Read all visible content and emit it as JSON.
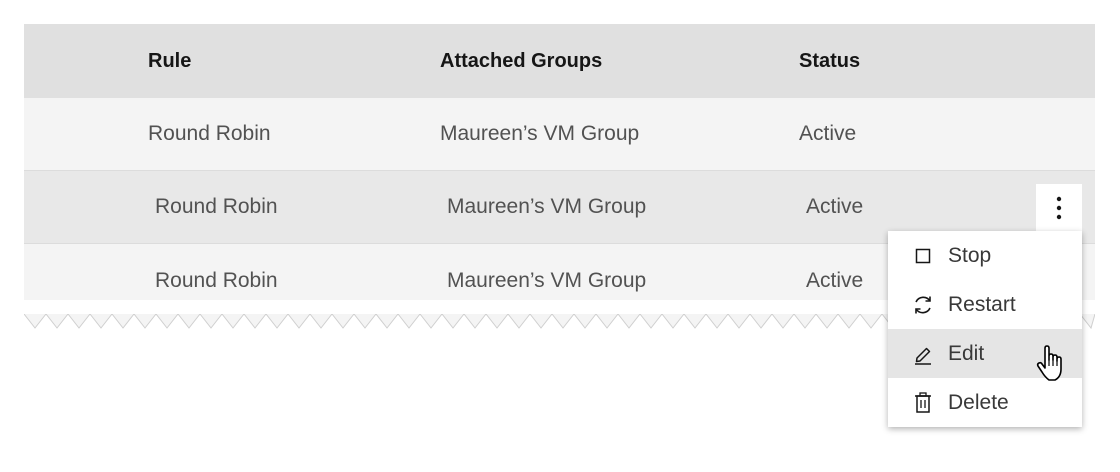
{
  "table": {
    "headers": {
      "rule": "Rule",
      "groups": "Attached Groups",
      "status": "Status"
    },
    "rows": [
      {
        "rule": "Round Robin",
        "groups": "Maureen’s VM Group",
        "status": "Active"
      },
      {
        "rule": "Round Robin",
        "groups": "Maureen’s VM Group",
        "status": "Active"
      },
      {
        "rule": "Round Robin",
        "groups": "Maureen’s VM Group",
        "status": "Active"
      }
    ]
  },
  "overflow_menu": {
    "items": [
      {
        "label": "Stop",
        "icon": "stop-icon"
      },
      {
        "label": "Restart",
        "icon": "restart-icon"
      },
      {
        "label": "Edit",
        "icon": "edit-icon",
        "hovered": true
      },
      {
        "label": "Delete",
        "icon": "trash-icon"
      }
    ]
  },
  "colors": {
    "header_bg": "#e0e0e0",
    "row_bg": "#f4f4f4",
    "row_hover_bg": "#e8e8e8",
    "menu_bg": "#ffffff",
    "menu_hover_bg": "#e5e5e5",
    "text_primary": "#161616",
    "text_secondary": "#525252"
  }
}
